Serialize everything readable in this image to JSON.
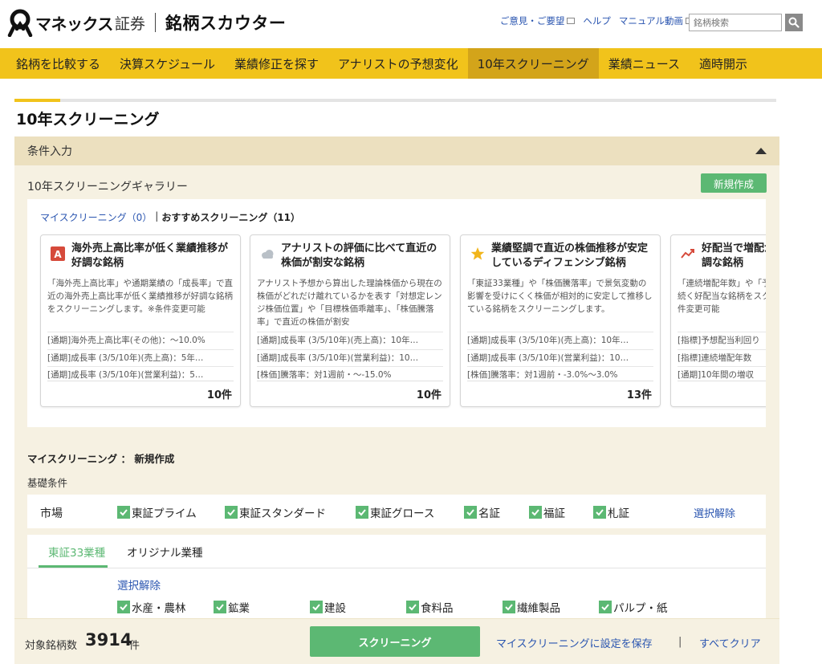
{
  "header": {
    "brand": "マネックス",
    "brand_suffix": "証券",
    "product": "銘柄スカウター",
    "links": [
      "ご意見・ご要望",
      "ヘルプ",
      "マニュアル動画"
    ],
    "search_placeholder": "銘柄検索"
  },
  "nav": {
    "items": [
      "銘柄を比較する",
      "決算スケジュール",
      "業績修正を探す",
      "アナリストの予想変化",
      "10年スクリーニング",
      "業績ニュース",
      "適時開示"
    ],
    "active_index": 4
  },
  "progress": {
    "fraction": 0.06
  },
  "page_title": "10年スクリーニング",
  "panel": {
    "title": "条件入力",
    "gallery_title": "10年スクリーニングギャラリー",
    "new_button": "新規作成",
    "tabs": {
      "my": "マイスクリーニング（0）",
      "sep": "|",
      "recommended": "おすすめスクリーニング（11）"
    },
    "cards": [
      {
        "icon": "letter-a-icon",
        "title": "海外売上高比率が低く業績推移が好調な銘柄",
        "desc": "「海外売上高比率」や通期業績の「成長率」で直近の海外売上高比率が低く業績推移が好調な銘柄をスクリーニングします。※条件変更可能",
        "conditions": [
          "[通期]海外売上高比率(その他)：〜10.0%",
          "[通期]成長率 (3/5/10年)(売上高)：5年…",
          "[通期]成長率 (3/5/10年)(営業利益)：5…"
        ],
        "count": "10件"
      },
      {
        "icon": "cloud-icon",
        "title": "アナリストの評価に比べて直近の株価が割安な銘柄",
        "desc": "アナリスト予想から算出した理論株価から現在の株価がどれだけ離れているかを表す「対想定レンジ株価位置」や「目標株価乖離率」、「株価騰落率」で直近の株価が割安",
        "conditions": [
          "[通期]成長率 (3/5/10年)(売上高)：10年…",
          "[通期]成長率 (3/5/10年)(営業利益)：10…",
          "[株価]騰落率：対1週前・〜-15.0%"
        ],
        "count": "10件"
      },
      {
        "icon": "star-icon",
        "title": "業績堅調で直近の株価推移が安定しているディフェンシブ銘柄",
        "desc": "「東証33業種」や「株価騰落率」で景気変動の影響を受けにくく株価が相対的に安定して推移している銘柄をスクリーニングします。",
        "conditions": [
          "[通期]成長率 (3/5/10年)(売上高)：10年…",
          "[通期]成長率 (3/5/10年)(営業利益)：10…",
          "[株価]騰落率：対1週前・-3.0%〜3.0%"
        ],
        "count": "13件"
      },
      {
        "icon": "trend-up-icon",
        "title": "好配当で増配が続き業績推移が好調な銘柄",
        "desc": "「連続増配年数」や「予想配当利回り」で増配が続く好配当な銘柄をスクリーニングします。※条件変更可能",
        "conditions": [
          "[指標]予想配当利回り",
          "[指標]連続増配年数",
          "[通期]10年間の増収"
        ],
        "count": ""
      }
    ],
    "my_title": "マイスクリーニング ： 新規作成",
    "basic_label": "基礎条件",
    "market": {
      "label": "市場",
      "options": [
        "東証プライム",
        "東証スタンダード",
        "東証グロース",
        "名証",
        "福証",
        "札証"
      ],
      "clear": "選択解除"
    },
    "sector": {
      "tabs": [
        "東証33業種",
        "オリジナル業種"
      ],
      "clear": "選択解除",
      "options": [
        "水産・農林",
        "鉱業",
        "建設",
        "食料品",
        "繊維製品",
        "パルプ・紙"
      ]
    }
  },
  "bottom": {
    "count_label": "対象銘柄数",
    "count": "3914",
    "count_unit": "件",
    "screen_button": "スクリーニング",
    "save_link": "マイスクリーニングに設定を保存",
    "sep": "|",
    "clear_all": "すべてクリア"
  },
  "colors": {
    "accent_yellow": "#f1c31b",
    "green": "#5cb873",
    "link": "#2a55b0",
    "panel_bg": "#f6f1e2"
  }
}
